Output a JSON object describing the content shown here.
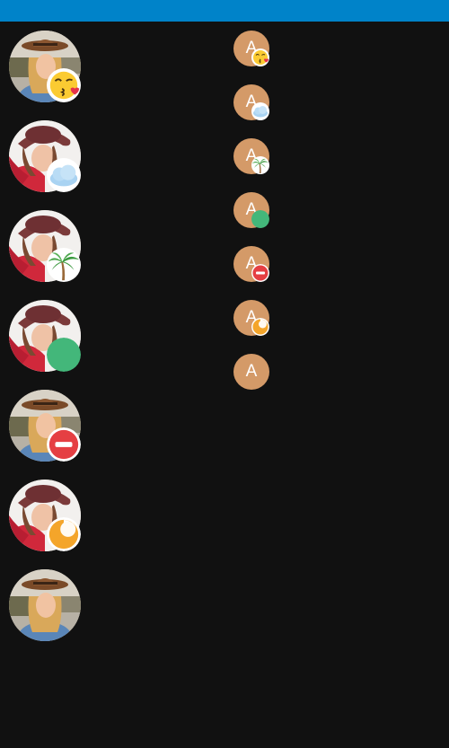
{
  "app_bar": {
    "color": "#0083c9"
  },
  "colors": {
    "background": "#111111",
    "initials_background": "#d49a68",
    "status_available": "#43b77a",
    "status_busy": "#e53f43",
    "status_away": "#f4a52a"
  },
  "avatars_large": [
    {
      "photo": "woman-photo-blonde",
      "badge": "kiss-emoji-icon"
    },
    {
      "photo": "woman-photo-red-hat",
      "badge": "cloud-icon"
    },
    {
      "photo": "woman-photo-red-hat",
      "badge": "palm-tree-icon"
    },
    {
      "photo": "woman-photo-red-hat",
      "badge": "available-status-icon"
    },
    {
      "photo": "woman-photo-blonde",
      "badge": "busy-status-icon"
    },
    {
      "photo": "woman-photo-red-hat",
      "badge": "away-status-icon"
    },
    {
      "photo": "woman-photo-blonde",
      "badge": "none"
    }
  ],
  "avatars_small": [
    {
      "initials": "A",
      "badge": "kiss-emoji-icon"
    },
    {
      "initials": "A",
      "badge": "cloud-icon"
    },
    {
      "initials": "A",
      "badge": "palm-tree-icon"
    },
    {
      "initials": "A",
      "badge": "available-status-icon"
    },
    {
      "initials": "A",
      "badge": "busy-status-icon"
    },
    {
      "initials": "A",
      "badge": "away-status-icon"
    },
    {
      "initials": "A",
      "badge": "none"
    }
  ]
}
